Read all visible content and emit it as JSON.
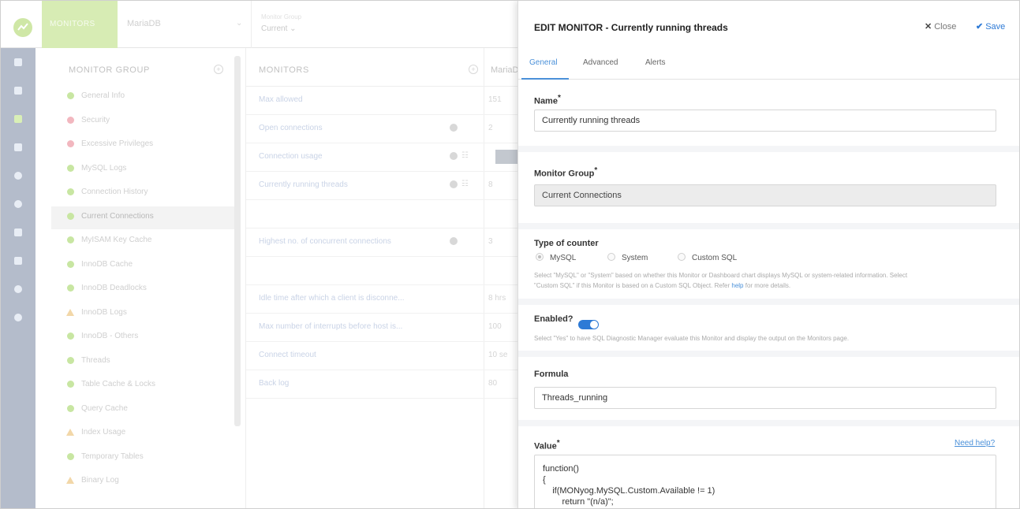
{
  "topbar": {
    "brand": "MONITORS",
    "server": "MariaDB",
    "group_label": "Monitor Group",
    "group_value": "Current"
  },
  "rail": {
    "icons": [
      "database-icon",
      "monitor-icon",
      "chart-icon",
      "report-icon",
      "clock-icon",
      "search-icon",
      "list-icon",
      "sliders-icon",
      "alert-icon",
      "settings-icon"
    ]
  },
  "groups": {
    "title": "MONITOR GROUP",
    "items": [
      {
        "label": "General Info",
        "icon": "dot",
        "color": "#c8e6a2"
      },
      {
        "label": "Security",
        "icon": "dot",
        "color": "#f2b7bf"
      },
      {
        "label": "Excessive Privileges",
        "icon": "dot",
        "color": "#f2b7bf"
      },
      {
        "label": "MySQL Logs",
        "icon": "dot",
        "color": "#c8e6a2"
      },
      {
        "label": "Connection History",
        "icon": "dot",
        "color": "#c8e6a2"
      },
      {
        "label": "Current Connections",
        "icon": "dot",
        "color": "#c8e6a2",
        "active": true
      },
      {
        "label": "MyISAM Key Cache",
        "icon": "dot",
        "color": "#c8e6a2"
      },
      {
        "label": "InnoDB Cache",
        "icon": "dot",
        "color": "#c8e6a2"
      },
      {
        "label": "InnoDB Deadlocks",
        "icon": "dot",
        "color": "#c8e6a2"
      },
      {
        "label": "InnoDB Logs",
        "icon": "triangle",
        "color": "#f2d7a8"
      },
      {
        "label": "InnoDB - Others",
        "icon": "dot",
        "color": "#c8e6a2"
      },
      {
        "label": "Threads",
        "icon": "dot",
        "color": "#c8e6a2"
      },
      {
        "label": "Table Cache & Locks",
        "icon": "dot",
        "color": "#c8e6a2"
      },
      {
        "label": "Query Cache",
        "icon": "dot",
        "color": "#c8e6a2"
      },
      {
        "label": "Index Usage",
        "icon": "triangle",
        "color": "#f2d7a8"
      },
      {
        "label": "Temporary Tables",
        "icon": "dot",
        "color": "#c8e6a2"
      },
      {
        "label": "Binary Log",
        "icon": "triangle",
        "color": "#f2d7a8"
      }
    ]
  },
  "monitors": {
    "title": "MONITORS",
    "col2": "MariaDB",
    "rows": [
      {
        "name": "Max allowed",
        "value": "151"
      },
      {
        "name": "Open connections",
        "value": "2",
        "edit": true
      },
      {
        "name": "Connection usage",
        "value": "",
        "edit": true,
        "graph": true,
        "bar": true
      },
      {
        "name": "Currently running threads",
        "value": "8",
        "edit": true,
        "graph": true
      },
      {
        "name": "",
        "value": ""
      },
      {
        "name": "Highest no. of concurrent connections",
        "value": "3",
        "edit": true
      },
      {
        "name": "",
        "value": ""
      },
      {
        "name": "Idle time after which a client is disconne...",
        "value": "8 hrs"
      },
      {
        "name": "Max number of interrupts before host is...",
        "value": "100"
      },
      {
        "name": "Connect timeout",
        "value": "10 se"
      },
      {
        "name": "Back log",
        "value": "80"
      }
    ]
  },
  "panel": {
    "title": "EDIT MONITOR",
    "subtitle": " - Currently running threads",
    "close": "Close",
    "save": "Save",
    "tabs": [
      "General",
      "Advanced",
      "Alerts"
    ],
    "name_label": "Name",
    "name_value": "Currently running threads",
    "group_label": "Monitor Group",
    "group_value": "Current Connections",
    "counter_label": "Type of counter",
    "counter_options": [
      "MySQL",
      "System",
      "Custom SQL"
    ],
    "counter_help_1": "Select \"MySQL\" or \"System\" based on whether this Monitor or Dashboard chart displays MySQL or system-related information. Select",
    "counter_help_2a": "\"Custom SQL\" if this Monitor is based on a Custom SQL Object. Refer ",
    "counter_help_link": "help",
    "counter_help_2b": " for more details.",
    "enabled_label": "Enabled?",
    "enabled": true,
    "enabled_help": "Select \"Yes\" to have SQL Diagnostic Manager evaluate this Monitor and display the output on the Monitors page.",
    "formula_label": "Formula",
    "formula_value": "Threads_running",
    "value_label": "Value",
    "need_help": "Need help?",
    "value_code": "function()\n{\n    if(MONyog.MySQL.Custom.Available != 1)\n        return \"(n/a)\";"
  }
}
